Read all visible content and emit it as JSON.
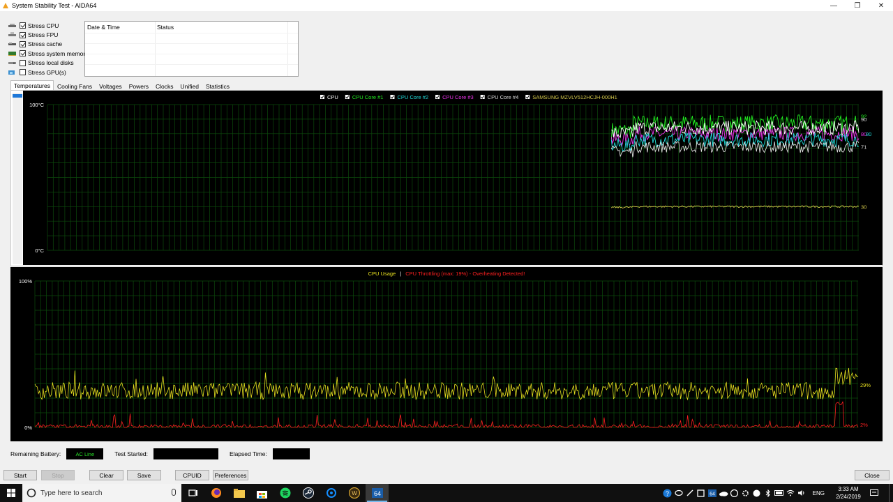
{
  "window": {
    "title": "System Stability Test - AIDA64",
    "minimize": "—",
    "maximize": "❐",
    "close": "✕"
  },
  "stress_options": [
    {
      "label": "Stress CPU",
      "checked": true,
      "icon": "cpu-icon"
    },
    {
      "label": "Stress FPU",
      "checked": true,
      "icon": "fpu-icon"
    },
    {
      "label": "Stress cache",
      "checked": true,
      "icon": "cache-icon"
    },
    {
      "label": "Stress system memory",
      "checked": true,
      "icon": "memory-icon"
    },
    {
      "label": "Stress local disks",
      "checked": false,
      "icon": "disk-icon"
    },
    {
      "label": "Stress GPU(s)",
      "checked": false,
      "icon": "gpu-icon"
    }
  ],
  "log": {
    "col_datetime": "Date & Time",
    "col_status": "Status"
  },
  "tabs": [
    "Temperatures",
    "Cooling Fans",
    "Voltages",
    "Powers",
    "Clocks",
    "Unified",
    "Statistics"
  ],
  "active_tab": "Temperatures",
  "chart_data": [
    {
      "type": "line",
      "title": "",
      "legend": [
        {
          "name": "CPU",
          "color": "#ffffff"
        },
        {
          "name": "CPU Core #1",
          "color": "#22ee22"
        },
        {
          "name": "CPU Core #2",
          "color": "#22dddd"
        },
        {
          "name": "CPU Core #3",
          "color": "#ee33ee"
        },
        {
          "name": "CPU Core #4",
          "color": "#dddddd"
        },
        {
          "name": "SAMSUNG MZVLV512HCJH-000H1",
          "color": "#d4c84a"
        }
      ],
      "ymax_label": "100°C",
      "ymin_label": "0°C",
      "ylim": [
        0,
        100
      ],
      "end_labels": [
        {
          "text": "92",
          "value": 92,
          "color": "#22ee22"
        },
        {
          "text": "90",
          "value": 90,
          "color": "#dddddd"
        },
        {
          "text": "80",
          "value": 80,
          "color": "#ee33ee"
        },
        {
          "text": "80",
          "value": 80,
          "color": "#22dddd"
        },
        {
          "text": "71",
          "value": 71,
          "color": "#dddddd"
        },
        {
          "text": "30",
          "value": 30,
          "color": "#d4c84a"
        }
      ],
      "series": [
        {
          "name": "CPU Core #1",
          "color": "#22ee22",
          "approx_level": 87,
          "noise": 6
        },
        {
          "name": "CPU Core #3",
          "color": "#ee33ee",
          "approx_level": 80,
          "noise": 5
        },
        {
          "name": "CPU",
          "color": "#ffffff",
          "approx_level": 84,
          "noise": 5
        },
        {
          "name": "CPU Core #2",
          "color": "#22dddd",
          "approx_level": 76,
          "noise": 5
        },
        {
          "name": "CPU Core #4",
          "color": "#dddddd",
          "approx_level": 71,
          "noise": 4
        },
        {
          "name": "SAMSUNG MZVLV512HCJH-000H1",
          "color": "#d4c84a",
          "approx_level": 30,
          "noise": 0.6
        }
      ]
    },
    {
      "type": "line",
      "title_usage": "CPU Usage",
      "title_sep": "|",
      "title_throttle": "CPU Throttling (max: 19%) - Overheating Detected!",
      "usage_color": "#e8e020",
      "throttle_color": "#ff2020",
      "ymax_label": "100%",
      "ymin_label": "0%",
      "ylim": [
        0,
        100
      ],
      "end_labels": [
        {
          "text": "29%",
          "value": 29,
          "color": "#e8e020"
        },
        {
          "text": "2%",
          "value": 2,
          "color": "#ff2020"
        }
      ],
      "series": [
        {
          "name": "CPU Usage",
          "color": "#e8e020",
          "approx_level": 25,
          "noise": 6
        },
        {
          "name": "CPU Throttling",
          "color": "#ff2020",
          "approx_level": 3,
          "noise": 3
        }
      ]
    }
  ],
  "status": {
    "battery_label": "Remaining Battery:",
    "battery_value": "AC Line",
    "started_label": "Test Started:",
    "started_value": "",
    "elapsed_label": "Elapsed Time:",
    "elapsed_value": ""
  },
  "buttons": {
    "start": "Start",
    "stop": "Stop",
    "clear": "Clear",
    "save": "Save",
    "cpuid": "CPUID",
    "preferences": "Preferences",
    "close": "Close"
  },
  "taskbar": {
    "search_placeholder": "Type here to search",
    "language": "ENG",
    "time": "3:33 AM",
    "date": "2/24/2019"
  }
}
